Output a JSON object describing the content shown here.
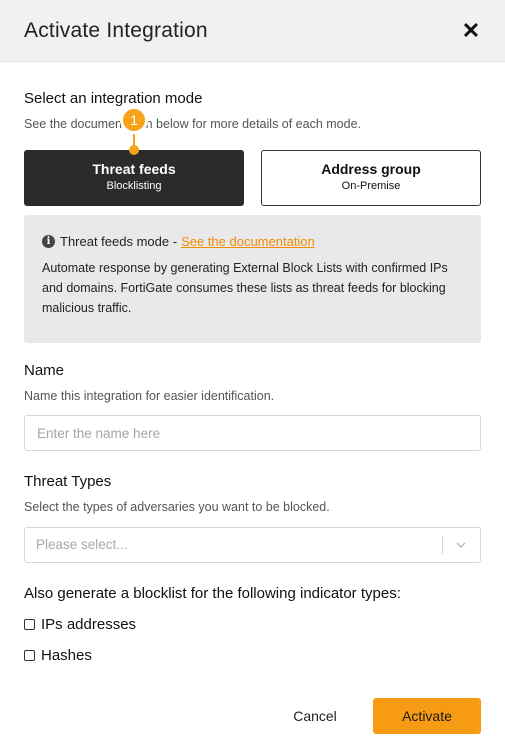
{
  "dialog": {
    "title": "Activate Integration",
    "close_glyph": "✕"
  },
  "mode_section": {
    "title": "Select an integration mode",
    "subtitle": "See the documentation below for more details of each mode.",
    "step_number": "1",
    "options": [
      {
        "title": "Threat feeds",
        "subtitle": "Blocklisting",
        "selected": true
      },
      {
        "title": "Address group",
        "subtitle": "On-Premise",
        "selected": false
      }
    ]
  },
  "info_box": {
    "icon": "info-icon",
    "heading": "Threat feeds mode -",
    "link_text": "See the documentation",
    "body": "Automate response by generating External Block Lists with confirmed IPs and domains. FortiGate consumes these lists as threat feeds for blocking malicious traffic."
  },
  "name_section": {
    "title": "Name",
    "subtitle": "Name this integration for easier identification.",
    "input_value": "",
    "input_placeholder": "Enter the name here"
  },
  "threat_types_section": {
    "title": "Threat Types",
    "subtitle": "Select the types of adversaries you want to be blocked.",
    "select_placeholder": "Please select..."
  },
  "indicators_section": {
    "title": "Also generate a blocklist for the following indicator types:",
    "options": [
      {
        "label": "IPs addresses",
        "checked": false
      },
      {
        "label": "Hashes",
        "checked": false
      }
    ]
  },
  "footer": {
    "cancel_label": "Cancel",
    "activate_label": "Activate"
  },
  "colors": {
    "accent": "#f79a14",
    "link": "#f08c00",
    "dark_button": "#2b2b2b",
    "info_bg": "#e9e9eb",
    "header_bg": "#f1f1f2"
  }
}
